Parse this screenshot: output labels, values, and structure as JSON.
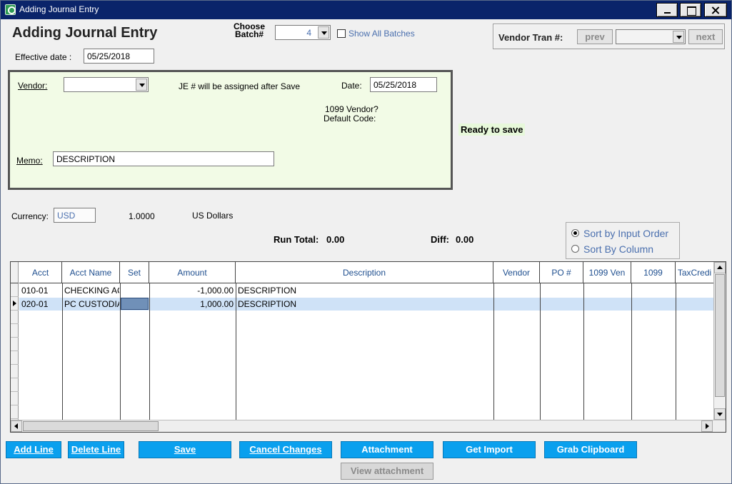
{
  "window": {
    "title": "Adding Journal Entry"
  },
  "header": {
    "heading": "Adding Journal Entry",
    "choose_batch_line1": "Choose",
    "choose_batch_line2": "Batch#",
    "batch_value": "4",
    "show_all_batches": "Show All Batches",
    "effective_date_label": "Effective date :",
    "effective_date": "05/25/2018"
  },
  "vendor_tran": {
    "label": "Vendor Tran #:",
    "prev": "prev",
    "next": "next"
  },
  "entry": {
    "vendor_label": "Vendor:",
    "je_note": "JE # will be assigned after Save",
    "date_label": "Date:",
    "date_value": "05/25/2018",
    "vendor_1099": "1099 Vendor?",
    "default_code": "Default Code:",
    "memo_label": "Memo:",
    "memo_value": "DESCRIPTION"
  },
  "status": {
    "ready": "Ready to save"
  },
  "currency": {
    "label": "Currency:",
    "code": "USD",
    "rate": "1.0000",
    "name": "US Dollars"
  },
  "totals": {
    "run_total_label": "Run Total:",
    "run_total": "0.00",
    "diff_label": "Diff:",
    "diff": "0.00"
  },
  "sort": {
    "input_order": "Sort by Input Order",
    "by_column": "Sort By Column",
    "selected": "input_order"
  },
  "grid": {
    "columns": [
      "Acct",
      "Acct Name",
      "Set",
      "Amount",
      "Description",
      "Vendor",
      "PO #",
      "1099 Ven",
      "1099",
      "TaxCredi"
    ],
    "rows": [
      {
        "acct": "010-01",
        "acct_name": "CHECKING AC",
        "set": "",
        "amount": "-1,000.00",
        "description": "DESCRIPTION"
      },
      {
        "acct": "020-01",
        "acct_name": "PC CUSTODIA",
        "set": "",
        "amount": "1,000.00",
        "description": "DESCRIPTION"
      }
    ]
  },
  "actions": {
    "add_line": "Add Line",
    "delete_line": "Delete Line",
    "save": "Save",
    "cancel_changes": "Cancel Changes",
    "attachment": "Attachment",
    "get_import": "Get Import",
    "grab_clipboard": "Grab Clipboard",
    "view_attachment": "View attachment"
  }
}
